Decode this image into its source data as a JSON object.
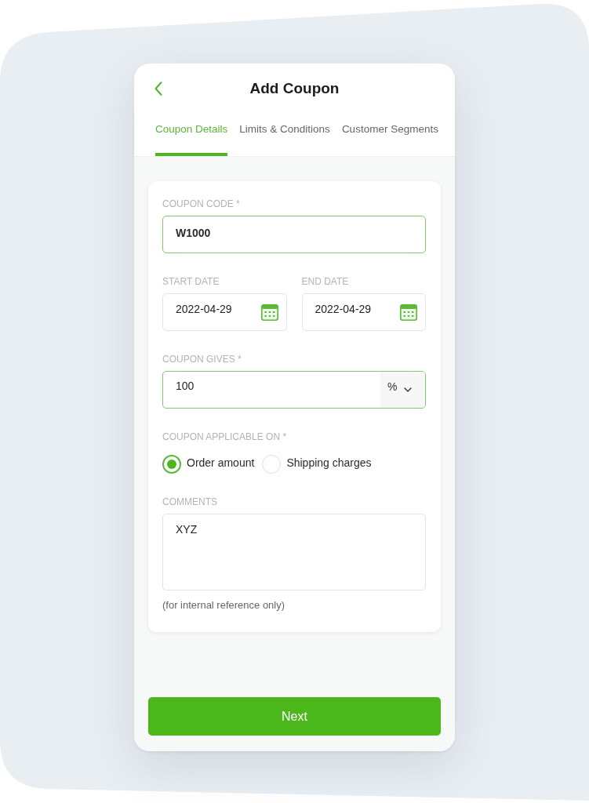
{
  "screen": {
    "title": "Add Coupon"
  },
  "tabs": [
    {
      "label": "Coupon Details",
      "selected": true
    },
    {
      "label": "Limits & Conditions",
      "selected": false
    },
    {
      "label": "Customer Segments",
      "selected": false
    }
  ],
  "form": {
    "fields": [
      {
        "kind": "text",
        "label": "COUPON CODE *",
        "value": "W1000",
        "active": true
      },
      {
        "kind": "row",
        "fields": [
          {
            "kind": "date",
            "label": "START DATE",
            "value": "2022-04-29",
            "active": false
          },
          {
            "kind": "date",
            "label": "END DATE",
            "value": "2022-04-29",
            "active": false
          }
        ]
      },
      {
        "kind": "amount",
        "label": "COUPON GIVES *",
        "value": "100",
        "unit": "%",
        "active": true
      },
      {
        "kind": "radio",
        "label": "COUPON APPLICABLE ON *",
        "options": [
          {
            "label": "Order amount",
            "selected": true
          },
          {
            "label": "Shipping charges",
            "selected": false
          }
        ]
      },
      {
        "kind": "textarea",
        "label": "COMMENTS",
        "value": "XYZ",
        "active": false,
        "helper_text": "(for internal reference only)"
      }
    ]
  },
  "primary_button": {
    "label": "Next"
  }
}
